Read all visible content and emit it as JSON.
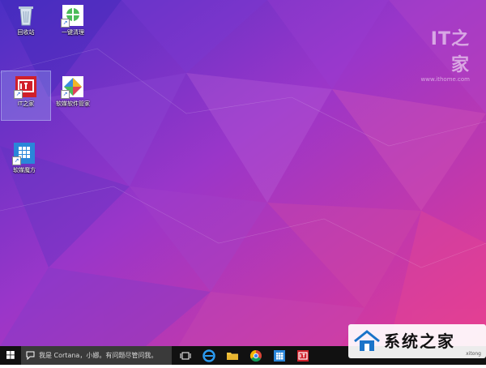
{
  "desktop": {
    "icons": [
      {
        "label": "回收站",
        "icon": "recycle-bin-icon"
      },
      {
        "label": "一键清理",
        "icon": "cleanup-icon"
      },
      {
        "label": "IT之家",
        "icon": "ithome-icon",
        "selected": true
      },
      {
        "label": "软媒软件管家",
        "icon": "software-manager-icon"
      },
      {
        "label": "软媒魔方",
        "icon": "rubik-cube-icon"
      }
    ],
    "watermark": {
      "logo_text": "IT之家",
      "url": "www.ithome.com"
    }
  },
  "taskbar": {
    "search_placeholder": "我是 Cortana，小娜。有问题尽管问我。",
    "apps": [
      {
        "icon": "task-view-icon"
      },
      {
        "icon": "edge-browser-icon"
      },
      {
        "icon": "file-explorer-icon"
      },
      {
        "icon": "chrome-icon"
      },
      {
        "icon": "rubik-cube-icon"
      },
      {
        "icon": "ithome-icon"
      }
    ]
  },
  "overlay": {
    "site_logo_text": "系统之家",
    "corner_text": "xitong"
  },
  "colors": {
    "wallpaper_from": "#5a2fc6",
    "wallpaper_mid": "#9a32c8",
    "wallpaper_to": "#e13a93",
    "taskbar": "#111111"
  }
}
